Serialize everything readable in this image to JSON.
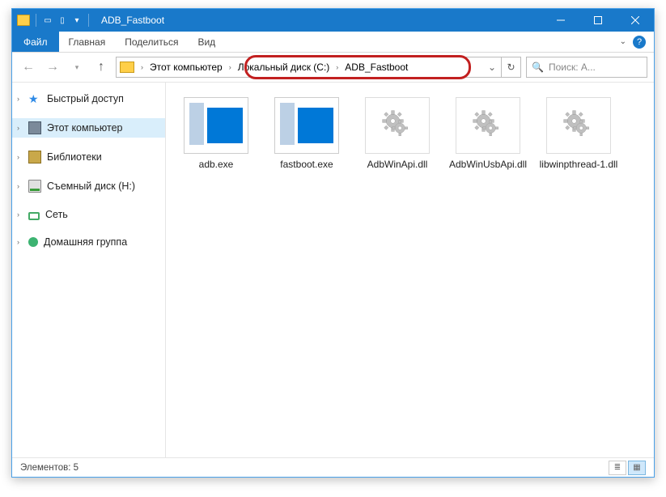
{
  "titlebar": {
    "title": "ADB_Fastboot"
  },
  "ribbon": {
    "file": "Файл",
    "tabs": [
      "Главная",
      "Поделиться",
      "Вид"
    ]
  },
  "address": {
    "segments": [
      "Этот компьютер",
      "Локальный диск (C:)",
      "ADB_Fastboot"
    ]
  },
  "search": {
    "placeholder": "Поиск: A..."
  },
  "sidebar": {
    "items": [
      {
        "label": "Быстрый доступ",
        "icon": "star",
        "expandable": true
      },
      {
        "label": "Этот компьютер",
        "icon": "pc",
        "expandable": true,
        "selected": true
      },
      {
        "label": "Библиотеки",
        "icon": "lib",
        "expandable": true
      },
      {
        "label": "Съемный диск (H:)",
        "icon": "drive",
        "expandable": true
      },
      {
        "label": "Сеть",
        "icon": "net",
        "expandable": true
      },
      {
        "label": "Домашняя группа",
        "icon": "home",
        "expandable": true
      }
    ]
  },
  "files": [
    {
      "name": "adb.exe",
      "type": "exe"
    },
    {
      "name": "fastboot.exe",
      "type": "exe"
    },
    {
      "name": "AdbWinApi.dll",
      "type": "dll"
    },
    {
      "name": "AdbWinUsbApi.dll",
      "type": "dll"
    },
    {
      "name": "libwinpthread-1.dll",
      "type": "dll"
    }
  ],
  "statusbar": {
    "items_label": "Элементов: 5"
  }
}
